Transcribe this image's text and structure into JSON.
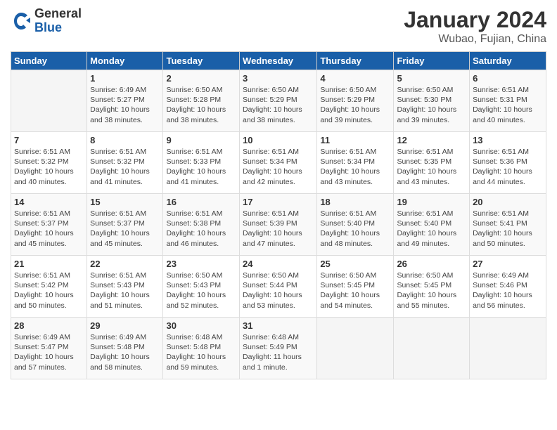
{
  "logo": {
    "general": "General",
    "blue": "Blue"
  },
  "title": "January 2024",
  "location": "Wubao, Fujian, China",
  "days_of_week": [
    "Sunday",
    "Monday",
    "Tuesday",
    "Wednesday",
    "Thursday",
    "Friday",
    "Saturday"
  ],
  "weeks": [
    [
      {
        "day": "",
        "info": ""
      },
      {
        "day": "1",
        "info": "Sunrise: 6:49 AM\nSunset: 5:27 PM\nDaylight: 10 hours\nand 38 minutes."
      },
      {
        "day": "2",
        "info": "Sunrise: 6:50 AM\nSunset: 5:28 PM\nDaylight: 10 hours\nand 38 minutes."
      },
      {
        "day": "3",
        "info": "Sunrise: 6:50 AM\nSunset: 5:29 PM\nDaylight: 10 hours\nand 38 minutes."
      },
      {
        "day": "4",
        "info": "Sunrise: 6:50 AM\nSunset: 5:29 PM\nDaylight: 10 hours\nand 39 minutes."
      },
      {
        "day": "5",
        "info": "Sunrise: 6:50 AM\nSunset: 5:30 PM\nDaylight: 10 hours\nand 39 minutes."
      },
      {
        "day": "6",
        "info": "Sunrise: 6:51 AM\nSunset: 5:31 PM\nDaylight: 10 hours\nand 40 minutes."
      }
    ],
    [
      {
        "day": "7",
        "info": "Sunrise: 6:51 AM\nSunset: 5:32 PM\nDaylight: 10 hours\nand 40 minutes."
      },
      {
        "day": "8",
        "info": "Sunrise: 6:51 AM\nSunset: 5:32 PM\nDaylight: 10 hours\nand 41 minutes."
      },
      {
        "day": "9",
        "info": "Sunrise: 6:51 AM\nSunset: 5:33 PM\nDaylight: 10 hours\nand 41 minutes."
      },
      {
        "day": "10",
        "info": "Sunrise: 6:51 AM\nSunset: 5:34 PM\nDaylight: 10 hours\nand 42 minutes."
      },
      {
        "day": "11",
        "info": "Sunrise: 6:51 AM\nSunset: 5:34 PM\nDaylight: 10 hours\nand 43 minutes."
      },
      {
        "day": "12",
        "info": "Sunrise: 6:51 AM\nSunset: 5:35 PM\nDaylight: 10 hours\nand 43 minutes."
      },
      {
        "day": "13",
        "info": "Sunrise: 6:51 AM\nSunset: 5:36 PM\nDaylight: 10 hours\nand 44 minutes."
      }
    ],
    [
      {
        "day": "14",
        "info": "Sunrise: 6:51 AM\nSunset: 5:37 PM\nDaylight: 10 hours\nand 45 minutes."
      },
      {
        "day": "15",
        "info": "Sunrise: 6:51 AM\nSunset: 5:37 PM\nDaylight: 10 hours\nand 45 minutes."
      },
      {
        "day": "16",
        "info": "Sunrise: 6:51 AM\nSunset: 5:38 PM\nDaylight: 10 hours\nand 46 minutes."
      },
      {
        "day": "17",
        "info": "Sunrise: 6:51 AM\nSunset: 5:39 PM\nDaylight: 10 hours\nand 47 minutes."
      },
      {
        "day": "18",
        "info": "Sunrise: 6:51 AM\nSunset: 5:40 PM\nDaylight: 10 hours\nand 48 minutes."
      },
      {
        "day": "19",
        "info": "Sunrise: 6:51 AM\nSunset: 5:40 PM\nDaylight: 10 hours\nand 49 minutes."
      },
      {
        "day": "20",
        "info": "Sunrise: 6:51 AM\nSunset: 5:41 PM\nDaylight: 10 hours\nand 50 minutes."
      }
    ],
    [
      {
        "day": "21",
        "info": "Sunrise: 6:51 AM\nSunset: 5:42 PM\nDaylight: 10 hours\nand 50 minutes."
      },
      {
        "day": "22",
        "info": "Sunrise: 6:51 AM\nSunset: 5:43 PM\nDaylight: 10 hours\nand 51 minutes."
      },
      {
        "day": "23",
        "info": "Sunrise: 6:50 AM\nSunset: 5:43 PM\nDaylight: 10 hours\nand 52 minutes."
      },
      {
        "day": "24",
        "info": "Sunrise: 6:50 AM\nSunset: 5:44 PM\nDaylight: 10 hours\nand 53 minutes."
      },
      {
        "day": "25",
        "info": "Sunrise: 6:50 AM\nSunset: 5:45 PM\nDaylight: 10 hours\nand 54 minutes."
      },
      {
        "day": "26",
        "info": "Sunrise: 6:50 AM\nSunset: 5:45 PM\nDaylight: 10 hours\nand 55 minutes."
      },
      {
        "day": "27",
        "info": "Sunrise: 6:49 AM\nSunset: 5:46 PM\nDaylight: 10 hours\nand 56 minutes."
      }
    ],
    [
      {
        "day": "28",
        "info": "Sunrise: 6:49 AM\nSunset: 5:47 PM\nDaylight: 10 hours\nand 57 minutes."
      },
      {
        "day": "29",
        "info": "Sunrise: 6:49 AM\nSunset: 5:48 PM\nDaylight: 10 hours\nand 58 minutes."
      },
      {
        "day": "30",
        "info": "Sunrise: 6:48 AM\nSunset: 5:48 PM\nDaylight: 10 hours\nand 59 minutes."
      },
      {
        "day": "31",
        "info": "Sunrise: 6:48 AM\nSunset: 5:49 PM\nDaylight: 11 hours\nand 1 minute."
      },
      {
        "day": "",
        "info": ""
      },
      {
        "day": "",
        "info": ""
      },
      {
        "day": "",
        "info": ""
      }
    ]
  ]
}
